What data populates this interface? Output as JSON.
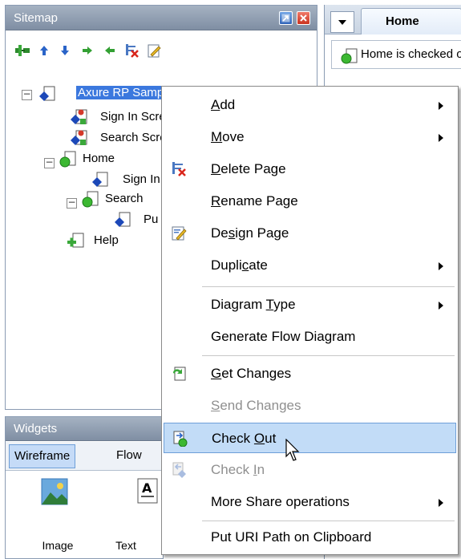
{
  "sitemap": {
    "title": "Sitemap",
    "toolbar_icons": [
      "add-page-icon",
      "move-up-icon",
      "move-down-icon",
      "indent-icon",
      "outdent-icon",
      "delete-page-icon",
      "edit-page-icon"
    ],
    "tree": [
      {
        "label": "Axure RP Sample",
        "selected": true
      },
      {
        "label": "Sign In Screen"
      },
      {
        "label": "Search Screen"
      },
      {
        "label": "Home"
      },
      {
        "label": "Sign In"
      },
      {
        "label": "Search"
      },
      {
        "label": "Pu"
      },
      {
        "label": "Help"
      }
    ]
  },
  "editor": {
    "tab_label": "Home",
    "status_text": "Home is checked out"
  },
  "widgets": {
    "title": "Widgets",
    "tabs": [
      "Wireframe",
      "Flow"
    ],
    "items": [
      {
        "label": "Image"
      },
      {
        "label": "Text"
      }
    ]
  },
  "context_menu": {
    "items": [
      {
        "pre": "",
        "key": "A",
        "post": "dd"
      },
      {
        "pre": "",
        "key": "M",
        "post": "ove"
      },
      {
        "pre": "",
        "key": "D",
        "post": "elete Page"
      },
      {
        "pre": "",
        "key": "R",
        "post": "ename Page"
      },
      {
        "pre": "De",
        "key": "s",
        "post": "ign Page"
      },
      {
        "pre": "Dupli",
        "key": "c",
        "post": "ate"
      },
      {
        "pre": "Diagram ",
        "key": "T",
        "post": "ype"
      },
      {
        "pre": "Generate Flow Diagram",
        "key": "",
        "post": ""
      },
      {
        "pre": "",
        "key": "G",
        "post": "et Changes"
      },
      {
        "pre": "",
        "key": "S",
        "post": "end Changes"
      },
      {
        "pre": "Check ",
        "key": "O",
        "post": "ut"
      },
      {
        "pre": "Check ",
        "key": "I",
        "post": "n"
      },
      {
        "pre": "More Share operations",
        "key": "",
        "post": ""
      },
      {
        "pre": "Put URI Path on Clipboard",
        "key": "",
        "post": ""
      }
    ]
  },
  "colors": {
    "selection": "#3b78de",
    "menu_highlight": "#c2dcf7",
    "header": "#8a9bb3",
    "disabled_text": "#8f8f8f"
  }
}
